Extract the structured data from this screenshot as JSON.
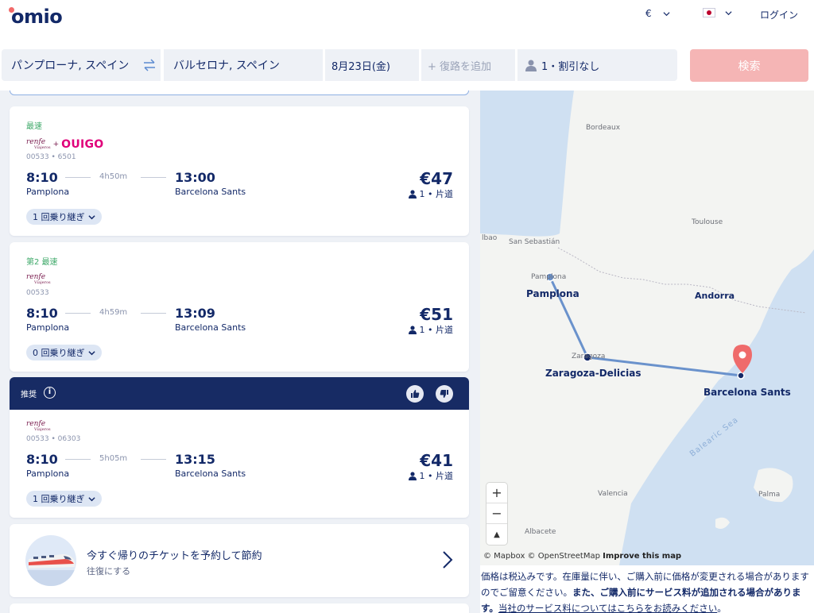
{
  "header": {
    "logo": "omio",
    "currency": "€",
    "login": "ログイン"
  },
  "search": {
    "from": "パンプローナ, スペイン",
    "to": "バルセロナ, スペイン",
    "date": "8月23日(金)",
    "return_placeholder": "+ 復路を追加",
    "passengers": "1・割引なし",
    "button": "検索"
  },
  "results": [
    {
      "tag": "最速",
      "carriers": [
        "renfe",
        "OUIGO"
      ],
      "codes": "00533 • 6501",
      "dep_time": "8:10",
      "duration": "4h50m",
      "arr_time": "13:00",
      "dep_station": "Pamplona",
      "arr_station": "Barcelona Sants",
      "price": "€47",
      "pax": "1 • 片道",
      "transfers": "1 回乗り継ぎ"
    },
    {
      "tag": "第2 最速",
      "carriers": [
        "renfe"
      ],
      "codes": "00533",
      "dep_time": "8:10",
      "duration": "4h59m",
      "arr_time": "13:09",
      "dep_station": "Pamplona",
      "arr_station": "Barcelona Sants",
      "price": "€51",
      "pax": "1 • 片道",
      "transfers": "0 回乗り継ぎ"
    },
    {
      "recommended_label": "推奨",
      "carriers": [
        "renfe"
      ],
      "codes": "00533 • 06303",
      "dep_time": "8:10",
      "duration": "5h05m",
      "arr_time": "13:15",
      "dep_station": "Pamplona",
      "arr_station": "Barcelona Sants",
      "price": "€41",
      "pax": "1 • 片道",
      "transfers": "1 回乗り継ぎ"
    }
  ],
  "carrier_logos": {
    "renfe": "renfe",
    "renfe_sub": "Viajeros",
    "plus": "+",
    "ouigo": "OUIGO"
  },
  "promo": {
    "title": "今すぐ帰りのチケットを予約して節約",
    "subtitle": "往復にする"
  },
  "map": {
    "labels": {
      "bordeaux": "Bordeaux",
      "toulouse": "Toulouse",
      "bilbao": "lbao",
      "san_sebastian": "San Sebastián",
      "pamplona_small": "Pamplona",
      "zaragoza_small": "Zaragoza",
      "valencia": "Valencia",
      "albacete": "Albacete",
      "palma": "Palma",
      "balearic_sea": "Balearic Sea"
    },
    "cities": {
      "pamplona": "Pamplona",
      "zaragoza": "Zaragoza-Delicias",
      "barcelona": "Barcelona Sants",
      "andorra": "Andorra"
    },
    "zoom_in": "+",
    "zoom_out": "−",
    "compass": "▲",
    "attribution_mapbox": "© Mapbox",
    "attribution_osm": "© OpenStreetMap",
    "attribution_improve": "Improve this map"
  },
  "note": {
    "text1": "価格は税込みです。在庫量に伴い、ご購入前に価格が変更される場合がありますのでご留意ください。",
    "text2": "また、ご購入前にサービス料が追加される場合があります。",
    "link": "当社のサービス料についてはこちらをお読みください",
    "end": "。"
  },
  "colors": {
    "navy": "#132968",
    "accent": "#f26a6a",
    "search_button": "#f5b5b5",
    "fast_tag": "#3fa96a",
    "route": "#6a92cc"
  }
}
